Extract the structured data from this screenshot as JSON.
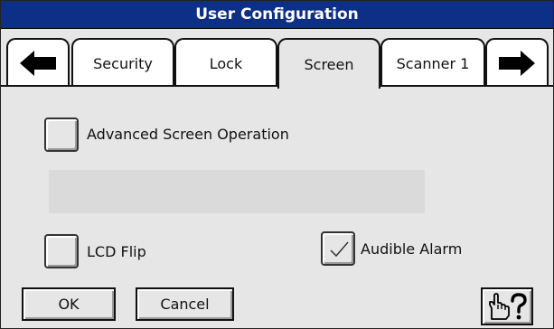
{
  "window": {
    "title": "User Configuration"
  },
  "tabs": [
    {
      "label": "Security",
      "active": false
    },
    {
      "label": "Lock",
      "active": false
    },
    {
      "label": "Screen",
      "active": true
    },
    {
      "label": "Scanner 1",
      "active": false
    }
  ],
  "nav": {
    "prev_icon": "arrow-left-icon",
    "next_icon": "arrow-right-icon"
  },
  "options": {
    "advanced_screen_operation": {
      "label": "Advanced Screen Operation",
      "checked": false
    },
    "lcd_flip": {
      "label": "LCD Flip",
      "checked": false
    },
    "audible_alarm": {
      "label": "Audible Alarm",
      "checked": true
    }
  },
  "buttons": {
    "ok_label": "OK",
    "cancel_label": "Cancel",
    "help_icon": "hand-question-icon"
  },
  "colors": {
    "titlebar": "#0e2f86",
    "background": "#e6e6e6",
    "tab_inactive": "#ffffff"
  }
}
